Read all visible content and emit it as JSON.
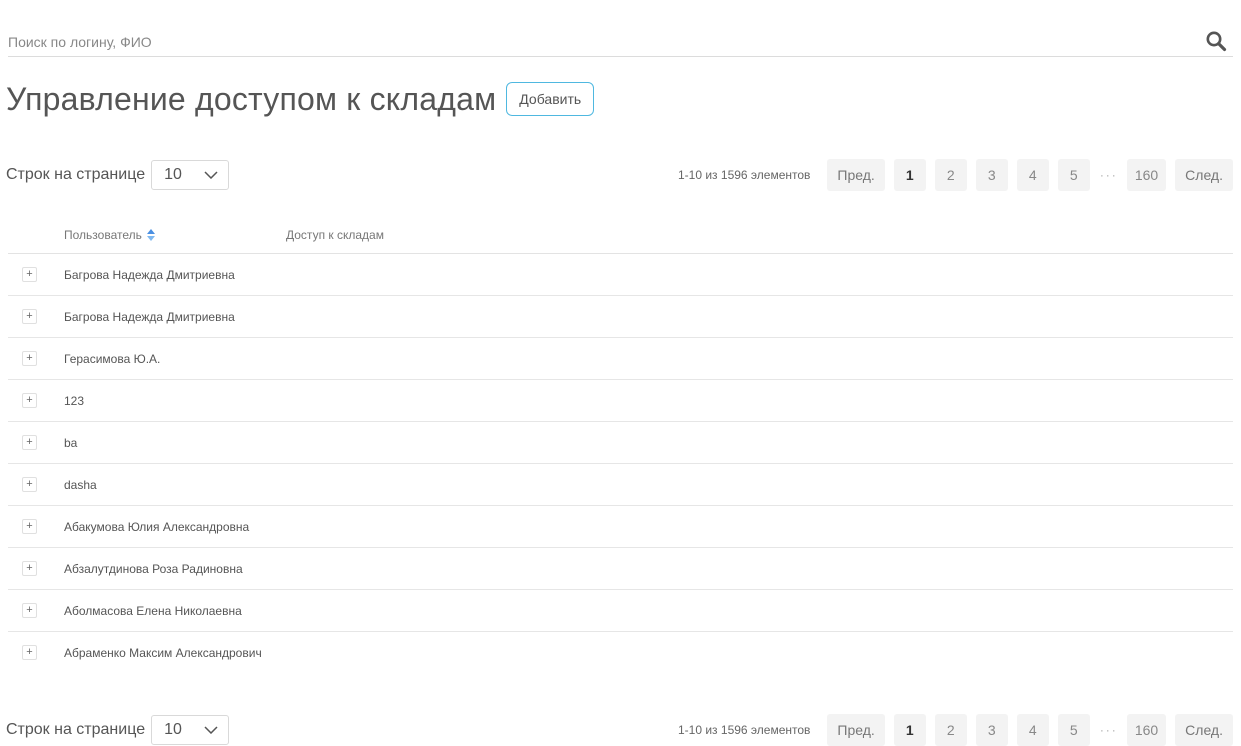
{
  "search": {
    "placeholder": "Поиск по логину, ФИО",
    "icon": "search-icon"
  },
  "header": {
    "title": "Управление доступом к складам",
    "add_label": "Добавить"
  },
  "pagination": {
    "rows_label": "Строк на странице",
    "rows_value": "10",
    "range_text": "1-10 из 1596 элементов",
    "prev_label": "Пред.",
    "next_label": "След.",
    "pages": [
      "1",
      "2",
      "3",
      "4",
      "5"
    ],
    "current_page": "1",
    "ellipsis": "···",
    "last_page": "160"
  },
  "table": {
    "columns": {
      "user": "Пользователь",
      "access": "Доступ к складам"
    },
    "expand_symbol": "+",
    "rows": [
      {
        "user": "Багрова Надежда Дмитриевна",
        "access": ""
      },
      {
        "user": "Багрова Надежда Дмитриевна",
        "access": ""
      },
      {
        "user": "Герасимова Ю.А.",
        "access": ""
      },
      {
        "user": "123",
        "access": ""
      },
      {
        "user": "ba",
        "access": ""
      },
      {
        "user": "dasha",
        "access": ""
      },
      {
        "user": "Абакумова Юлия Александровна",
        "access": ""
      },
      {
        "user": "Абзалутдинова Роза Радиновна",
        "access": ""
      },
      {
        "user": "Аболмасова Елена Николаевна",
        "access": ""
      },
      {
        "user": "Абраменко Максим Александрович",
        "access": ""
      }
    ]
  },
  "colors": {
    "accent": "#4fb8e0",
    "sort_up": "#4a90e2",
    "sort_down": "#7fb8f0",
    "page_bg": "#f3f3f3"
  }
}
